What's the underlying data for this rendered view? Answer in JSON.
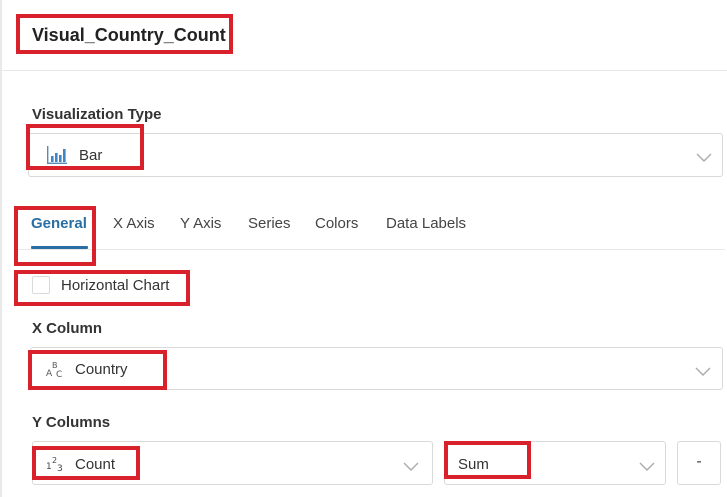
{
  "header": {
    "title": "Visual_Country_Count"
  },
  "visualization_type": {
    "label": "Visualization Type",
    "selected": "Bar",
    "icon": "bar-chart-icon"
  },
  "tabs": [
    {
      "label": "General",
      "active": true
    },
    {
      "label": "X Axis",
      "active": false
    },
    {
      "label": "Y Axis",
      "active": false
    },
    {
      "label": "Series",
      "active": false
    },
    {
      "label": "Colors",
      "active": false
    },
    {
      "label": "Data Labels",
      "active": false
    }
  ],
  "horizontal_chart": {
    "label": "Horizontal Chart",
    "checked": false
  },
  "x_column": {
    "label": "X Column",
    "selected": "Country",
    "icon": "text-type-icon"
  },
  "y_columns": {
    "label": "Y Columns",
    "column": "Count",
    "column_icon": "number-type-icon",
    "aggregation": "Sum",
    "remove_label": "-"
  },
  "colors": {
    "accent": "#2a6fa3",
    "highlight": "#d9212c",
    "border": "#d9d9d9"
  }
}
